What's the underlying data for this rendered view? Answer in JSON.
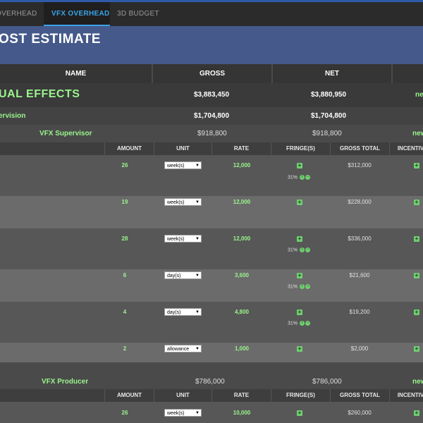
{
  "tabs": [
    {
      "label": "OVERHEAD"
    },
    {
      "label": "VFX OVERHEAD"
    },
    {
      "label": "3D BUDGET"
    }
  ],
  "banner": {
    "title": "OST ESTIMATE"
  },
  "columns": {
    "name": "NAME",
    "gross": "GROSS",
    "net": "NET"
  },
  "visual_effects": {
    "title": "UAL EFFECTS",
    "gross": "$3,883,450",
    "net": "$3,880,950",
    "new": "ne"
  },
  "supervision": {
    "title": "ervision",
    "gross": "$1,704,800",
    "net": "$1,704,800"
  },
  "detail_headers": {
    "amount": "AMOUNT",
    "unit": "UNIT",
    "rate": "RATE",
    "fringes": "FRINGE(S)",
    "gross_total": "GROSS TOTAL",
    "incentives": "INCENTIV"
  },
  "vfx_supervisor": {
    "title": "VFX Supervisor",
    "gross": "$918,800",
    "net": "$918,800",
    "new": "new",
    "lines": [
      {
        "amount": "26",
        "unit": "week(s)",
        "rate": "12,000",
        "fringe": "31%",
        "gross_total": "$312,000"
      },
      {
        "amount": "19",
        "unit": "week(s)",
        "rate": "12,000",
        "fringe": "",
        "gross_total": "$228,000"
      },
      {
        "amount": "28",
        "unit": "week(s)",
        "rate": "12,000",
        "fringe": "31%",
        "gross_total": "$336,000"
      },
      {
        "amount": "6",
        "unit": "day(s)",
        "rate": "3,600",
        "fringe": "31%",
        "gross_total": "$21,600"
      },
      {
        "amount": "4",
        "unit": "day(s)",
        "rate": "4,800",
        "fringe": "31%",
        "gross_total": "$19,200"
      },
      {
        "amount": "2",
        "unit": "allowance",
        "rate": "1,000",
        "fringe": "",
        "gross_total": "$2,000"
      }
    ]
  },
  "vfx_producer": {
    "title": "VFX Producer",
    "gross": "$786,000",
    "net": "$786,000",
    "new": "new",
    "lines": [
      {
        "amount": "26",
        "unit": "week(s)",
        "rate": "10,000",
        "fringe": "",
        "gross_total": "$260,000"
      }
    ]
  },
  "icons": {
    "plus": "plus-icon",
    "info": "info-icon",
    "minus": "minus-icon",
    "dropdown": "caret-down-icon"
  },
  "colors": {
    "accent_green": "#9af58c",
    "tab_active": "#3aa4e8",
    "banner": "#45598a"
  }
}
